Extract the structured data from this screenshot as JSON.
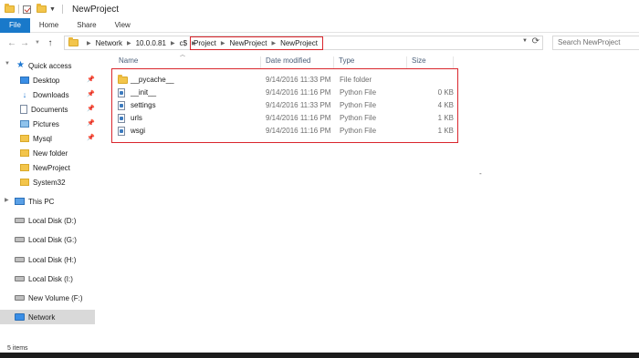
{
  "window": {
    "title": "NewProject"
  },
  "ribbon": {
    "tabs": [
      "File",
      "Home",
      "Share",
      "View"
    ]
  },
  "address": {
    "crumbs": [
      "Network",
      "10.0.0.81",
      "c$"
    ],
    "highlighted_crumbs": [
      "Project",
      "NewProject",
      "NewProject"
    ]
  },
  "search": {
    "placeholder": "Search NewProject"
  },
  "sidebar": {
    "quick_access": "Quick access",
    "items": [
      {
        "label": "Desktop",
        "icon": "desktop-icon",
        "pinned": true
      },
      {
        "label": "Downloads",
        "icon": "download-icon",
        "pinned": true
      },
      {
        "label": "Documents",
        "icon": "documents-icon",
        "pinned": true
      },
      {
        "label": "Pictures",
        "icon": "pictures-icon",
        "pinned": true
      },
      {
        "label": "Mysql",
        "icon": "folder-icon",
        "pinned": true
      },
      {
        "label": "New folder",
        "icon": "folder-icon",
        "pinned": false
      },
      {
        "label": "NewProject",
        "icon": "folder-icon",
        "pinned": false
      },
      {
        "label": "System32",
        "icon": "folder-icon",
        "pinned": false
      }
    ],
    "this_pc": "This PC",
    "drives": [
      "Local Disk (D:)",
      "Local Disk (G:)",
      "Local Disk (H:)",
      "Local Disk (I:)",
      "New Volume (F:)"
    ],
    "network": "Network"
  },
  "columns": {
    "name": "Name",
    "date": "Date modified",
    "type": "Type",
    "size": "Size"
  },
  "files": [
    {
      "name": "__pycache__",
      "date": "9/14/2016 11:33 PM",
      "type": "File folder",
      "size": "",
      "icon": "folder-icon"
    },
    {
      "name": "__init__",
      "date": "9/14/2016 11:16 PM",
      "type": "Python File",
      "size": "0 KB",
      "icon": "python-file-icon"
    },
    {
      "name": "settings",
      "date": "9/14/2016 11:33 PM",
      "type": "Python File",
      "size": "4 KB",
      "icon": "python-file-icon"
    },
    {
      "name": "urls",
      "date": "9/14/2016 11:16 PM",
      "type": "Python File",
      "size": "1 KB",
      "icon": "python-file-icon"
    },
    {
      "name": "wsgi",
      "date": "9/14/2016 11:16 PM",
      "type": "Python File",
      "size": "1 KB",
      "icon": "python-file-icon"
    }
  ],
  "status": {
    "items_count": "5 items"
  },
  "colors": {
    "accent": "#1979ca",
    "highlight_border": "#d9262c",
    "folder": "#f3c54b"
  }
}
